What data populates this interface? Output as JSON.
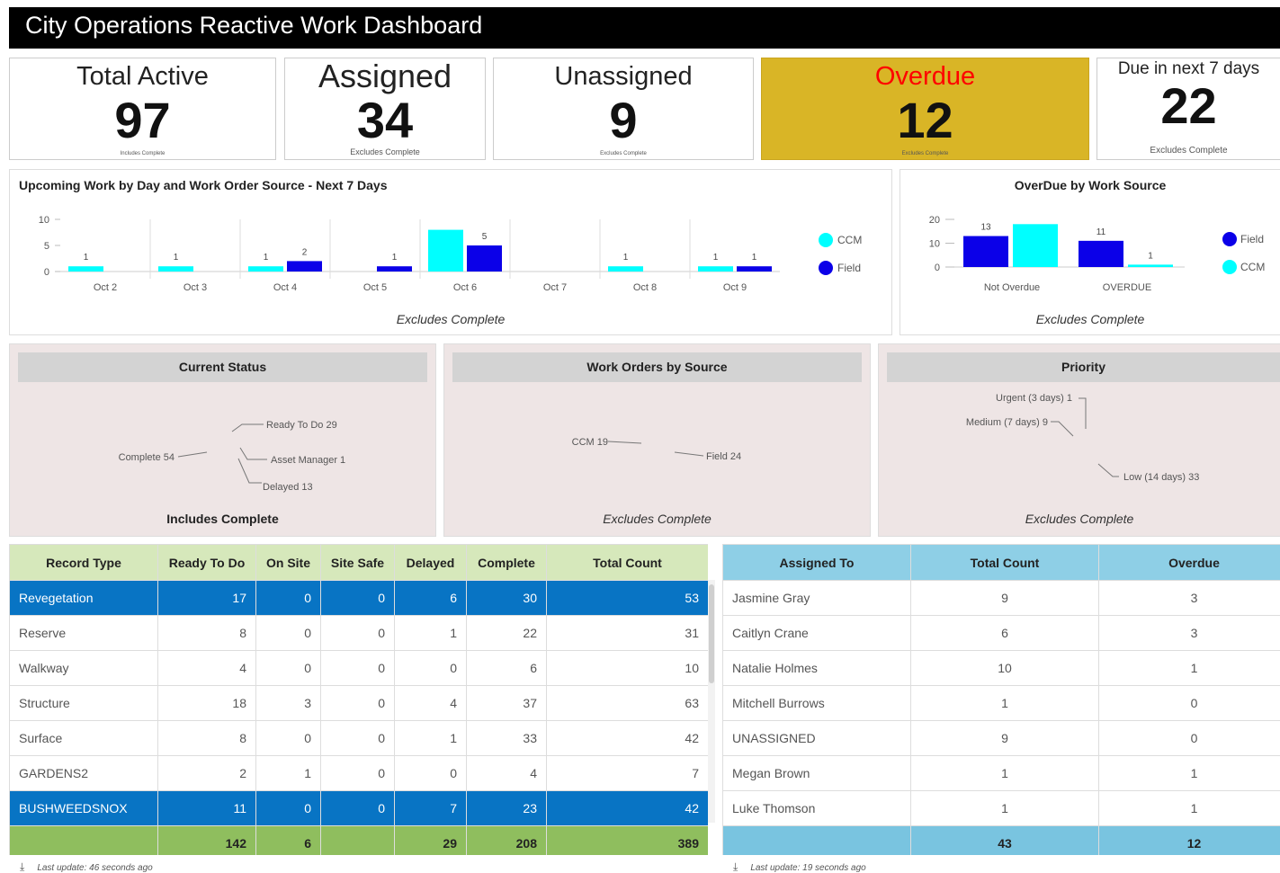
{
  "header": {
    "title": "City Operations Reactive Work Dashboard"
  },
  "kpis": [
    {
      "title": "Total Active",
      "value": "97",
      "note": "Includes Complete"
    },
    {
      "title": "Assigned",
      "value": "34",
      "note": "Excludes Complete"
    },
    {
      "title": "Unassigned",
      "value": "9",
      "note": "Excludes Complete"
    },
    {
      "title": "Overdue",
      "value": "12",
      "note": "Excludes Complete",
      "title_color": "#ff0000",
      "bg": "#d9b526"
    },
    {
      "title": "Due in next 7 days",
      "value": "22",
      "note": "Excludes Complete"
    }
  ],
  "upcoming": {
    "title": "Upcoming Work by Day and Work Order Source - Next 7 Days",
    "footer": "Excludes Complete"
  },
  "overdue_chart": {
    "title": "OverDue by Work Source",
    "footer": "Excludes Complete"
  },
  "chart_data": [
    {
      "type": "bar",
      "title": "Upcoming Work by Day and Work Order Source - Next 7 Days",
      "categories": [
        "Oct 2",
        "Oct 3",
        "Oct 4",
        "Oct 5",
        "Oct 6",
        "Oct 7",
        "Oct 8",
        "Oct 9"
      ],
      "yticks": [
        0,
        5,
        10
      ],
      "ylim": [
        0,
        10
      ],
      "series": [
        {
          "name": "CCM",
          "color": "#00ffff",
          "values": [
            1,
            1,
            1,
            0,
            8,
            0,
            1,
            1
          ]
        },
        {
          "name": "Field",
          "color": "#0b00e8",
          "values": [
            0,
            0,
            2,
            1,
            5,
            0,
            0,
            1
          ]
        }
      ],
      "data_labels": [
        [
          "1",
          "1",
          "1",
          "",
          "",
          "",
          "1",
          "1"
        ],
        [
          "",
          "",
          "2",
          "1",
          "5",
          "",
          "",
          "1"
        ]
      ],
      "legend": "right"
    },
    {
      "type": "bar",
      "title": "OverDue by Work Source",
      "categories": [
        "Not Overdue",
        "OVERDUE"
      ],
      "yticks": [
        0,
        10,
        20
      ],
      "ylim": [
        0,
        20
      ],
      "series": [
        {
          "name": "Field",
          "color": "#0b00e8",
          "values": [
            13,
            11
          ]
        },
        {
          "name": "CCM",
          "color": "#00ffff",
          "values": [
            18,
            1
          ]
        }
      ],
      "data_labels": [
        [
          "13",
          "11"
        ],
        [
          "",
          "1"
        ]
      ],
      "legend": "right"
    },
    {
      "type": "pie",
      "title": "Current Status",
      "subtitle": "Includes Complete",
      "slices": [
        {
          "label": "Complete 54",
          "value": 54,
          "color": "#111111"
        },
        {
          "label": "Ready To Do 29",
          "value": 29,
          "color": "#f4a21c"
        },
        {
          "label": "Asset Manager 1",
          "value": 1,
          "color": "#999999"
        },
        {
          "label": "Delayed 13",
          "value": 13,
          "color": "#e8202a"
        }
      ]
    },
    {
      "type": "pie",
      "title": "Work Orders by Source",
      "subtitle": "Excludes Complete",
      "slices": [
        {
          "label": "CCM 19",
          "value": 19,
          "color": "#00ffff"
        },
        {
          "label": "Field 24",
          "value": 24,
          "color": "#0b00e8"
        }
      ]
    },
    {
      "type": "pie",
      "title": "Priority",
      "subtitle": "Excludes Complete",
      "slices": [
        {
          "label": "Urgent (3 days) 1",
          "value": 1,
          "color": "#e6a95c"
        },
        {
          "label": "Medium (7 days) 9",
          "value": 9,
          "color": "#fcd7a6"
        },
        {
          "label": "Low (14 days) 33",
          "value": 33,
          "color": "#fdebd4"
        }
      ]
    }
  ],
  "record_table": {
    "headers": [
      "Record Type",
      "Ready To Do",
      "On Site",
      "Site Safe",
      "Delayed",
      "Complete",
      "Total Count"
    ],
    "rows": [
      [
        "Revegetation",
        "17",
        "0",
        "0",
        "6",
        "30",
        "53"
      ],
      [
        "Reserve",
        "8",
        "0",
        "0",
        "1",
        "22",
        "31"
      ],
      [
        "Walkway",
        "4",
        "0",
        "0",
        "0",
        "6",
        "10"
      ],
      [
        "Structure",
        "18",
        "3",
        "0",
        "4",
        "37",
        "63"
      ],
      [
        "Surface",
        "8",
        "0",
        "0",
        "1",
        "33",
        "42"
      ],
      [
        "GARDENS2",
        "2",
        "1",
        "0",
        "0",
        "4",
        "7"
      ],
      [
        "BUSHWEEDSNOX",
        "11",
        "0",
        "0",
        "7",
        "23",
        "42"
      ]
    ],
    "selected": [
      0,
      6
    ],
    "totals": [
      "",
      "142",
      "6",
      "",
      "29",
      "208",
      "389"
    ],
    "last_update": "Last update: 46 seconds ago"
  },
  "assigned_table": {
    "headers": [
      "Assigned To",
      "Total Count",
      "Overdue"
    ],
    "rows": [
      [
        "Jasmine Gray",
        "9",
        "3"
      ],
      [
        "Caitlyn Crane",
        "6",
        "3"
      ],
      [
        "Natalie Holmes",
        "10",
        "1"
      ],
      [
        "Mitchell Burrows",
        "1",
        "0"
      ],
      [
        "UNASSIGNED",
        "9",
        "0"
      ],
      [
        "Megan Brown",
        "1",
        "1"
      ],
      [
        "Luke Thomson",
        "1",
        "1"
      ]
    ],
    "totals": [
      "",
      "43",
      "12"
    ],
    "last_update": "Last update: 19 seconds ago"
  },
  "icons": {
    "download": "download-icon"
  }
}
